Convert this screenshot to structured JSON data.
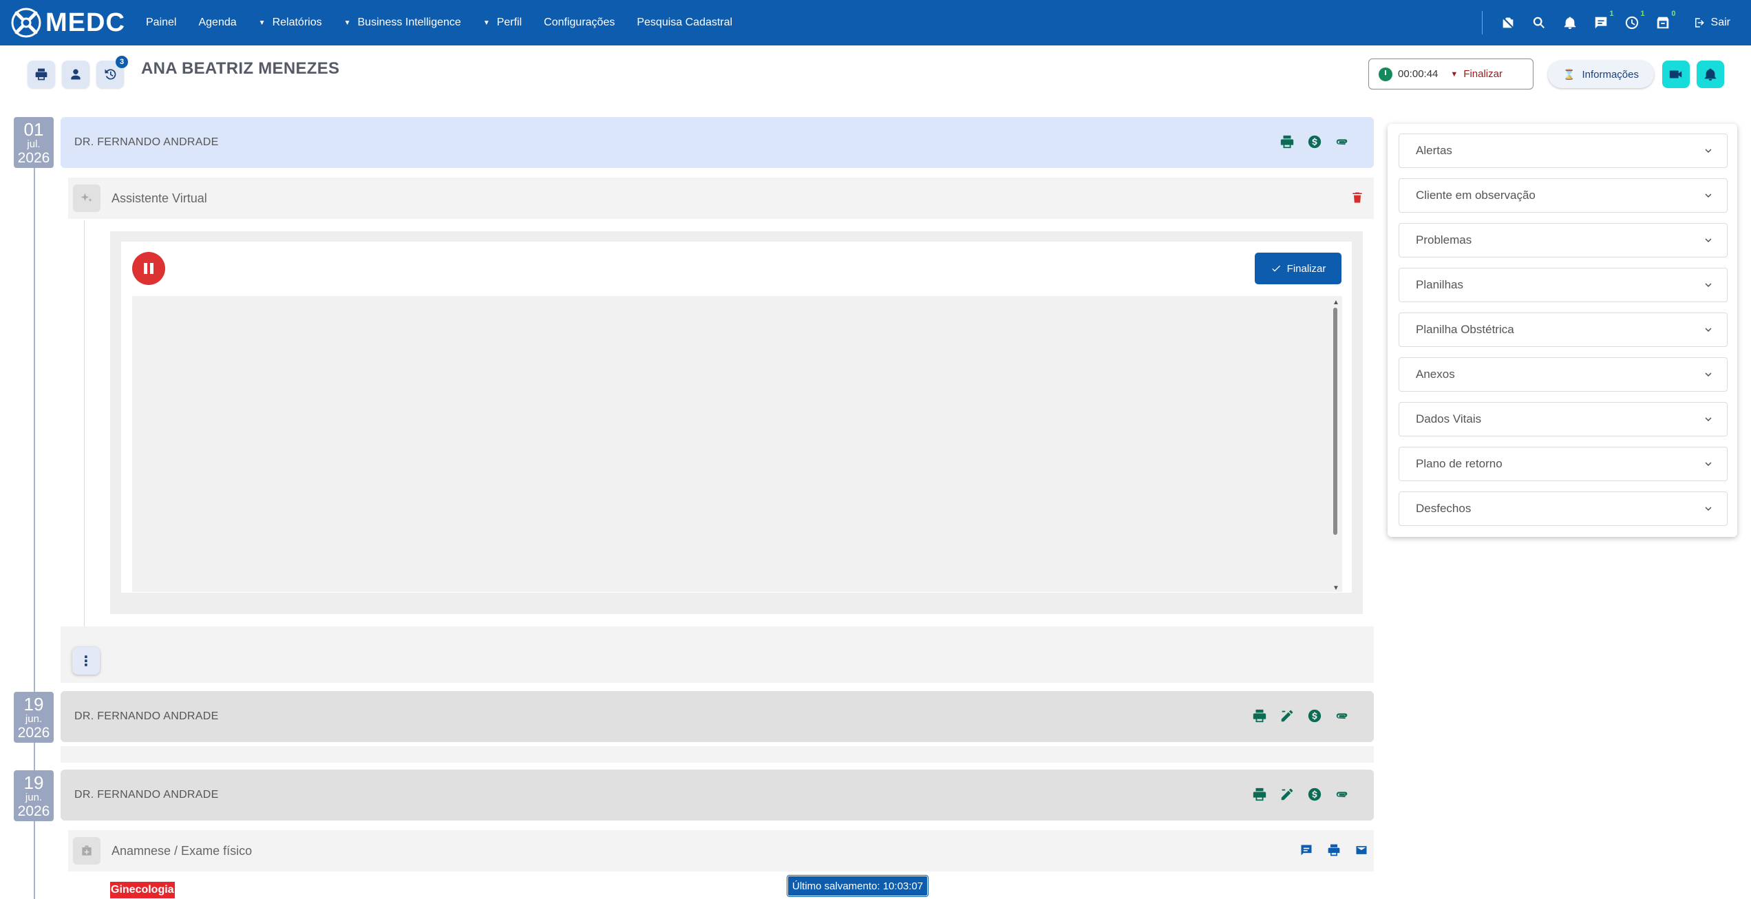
{
  "app": {
    "logo_text": "MEDC"
  },
  "nav": {
    "items": [
      {
        "label": "Painel",
        "dropdown": false
      },
      {
        "label": "Agenda",
        "dropdown": false
      },
      {
        "label": "Relatórios",
        "dropdown": true
      },
      {
        "label": "Business Intelligence",
        "dropdown": true
      },
      {
        "label": "Perfil",
        "dropdown": true
      },
      {
        "label": "Configurações",
        "dropdown": false
      },
      {
        "label": "Pesquisa Cadastral",
        "dropdown": false
      }
    ],
    "icons": {
      "chat_count": "1",
      "clock_count": "1",
      "box_count": "0"
    },
    "logout_label": "Sair"
  },
  "patient": {
    "name": "ANA BEATRIZ MENEZES",
    "history_badge": "3"
  },
  "session": {
    "timer": "00:00:44",
    "finish_label": "Finalizar",
    "info_label": "Informações"
  },
  "timeline": {
    "entries": [
      {
        "day": "01",
        "month": "jul.",
        "year": "2026",
        "doctor": "DR. FERNANDO ANDRADE"
      },
      {
        "day": "19",
        "month": "jun.",
        "year": "2026",
        "doctor": "DR. FERNANDO ANDRADE"
      },
      {
        "day": "19",
        "month": "jun.",
        "year": "2026",
        "doctor": "DR. FERNANDO ANDRADE"
      }
    ],
    "virtual_assistant": {
      "title": "Assistente Virtual",
      "finish_label": "Finalizar",
      "transcript": ""
    },
    "anamnese": {
      "title": "Anamnese / Exame físico",
      "specialty_tag": "Ginecologia",
      "saved_label": "Último salvamento: 10:03:07"
    }
  },
  "side_panel": {
    "sections": [
      "Alertas",
      "Cliente em observação",
      "Problemas",
      "Planilhas",
      "Planilha Obstétrica",
      "Anexos",
      "Dados Vitais",
      "Plano de retorno",
      "Desfechos"
    ]
  },
  "colors": {
    "primary": "#0d5cad",
    "accent_cyan": "#17dcd9",
    "danger": "#dc3232",
    "action_green": "#0b6b55",
    "entry_highlight": "#dce6fb",
    "entry_muted": "#e0e0e0"
  }
}
